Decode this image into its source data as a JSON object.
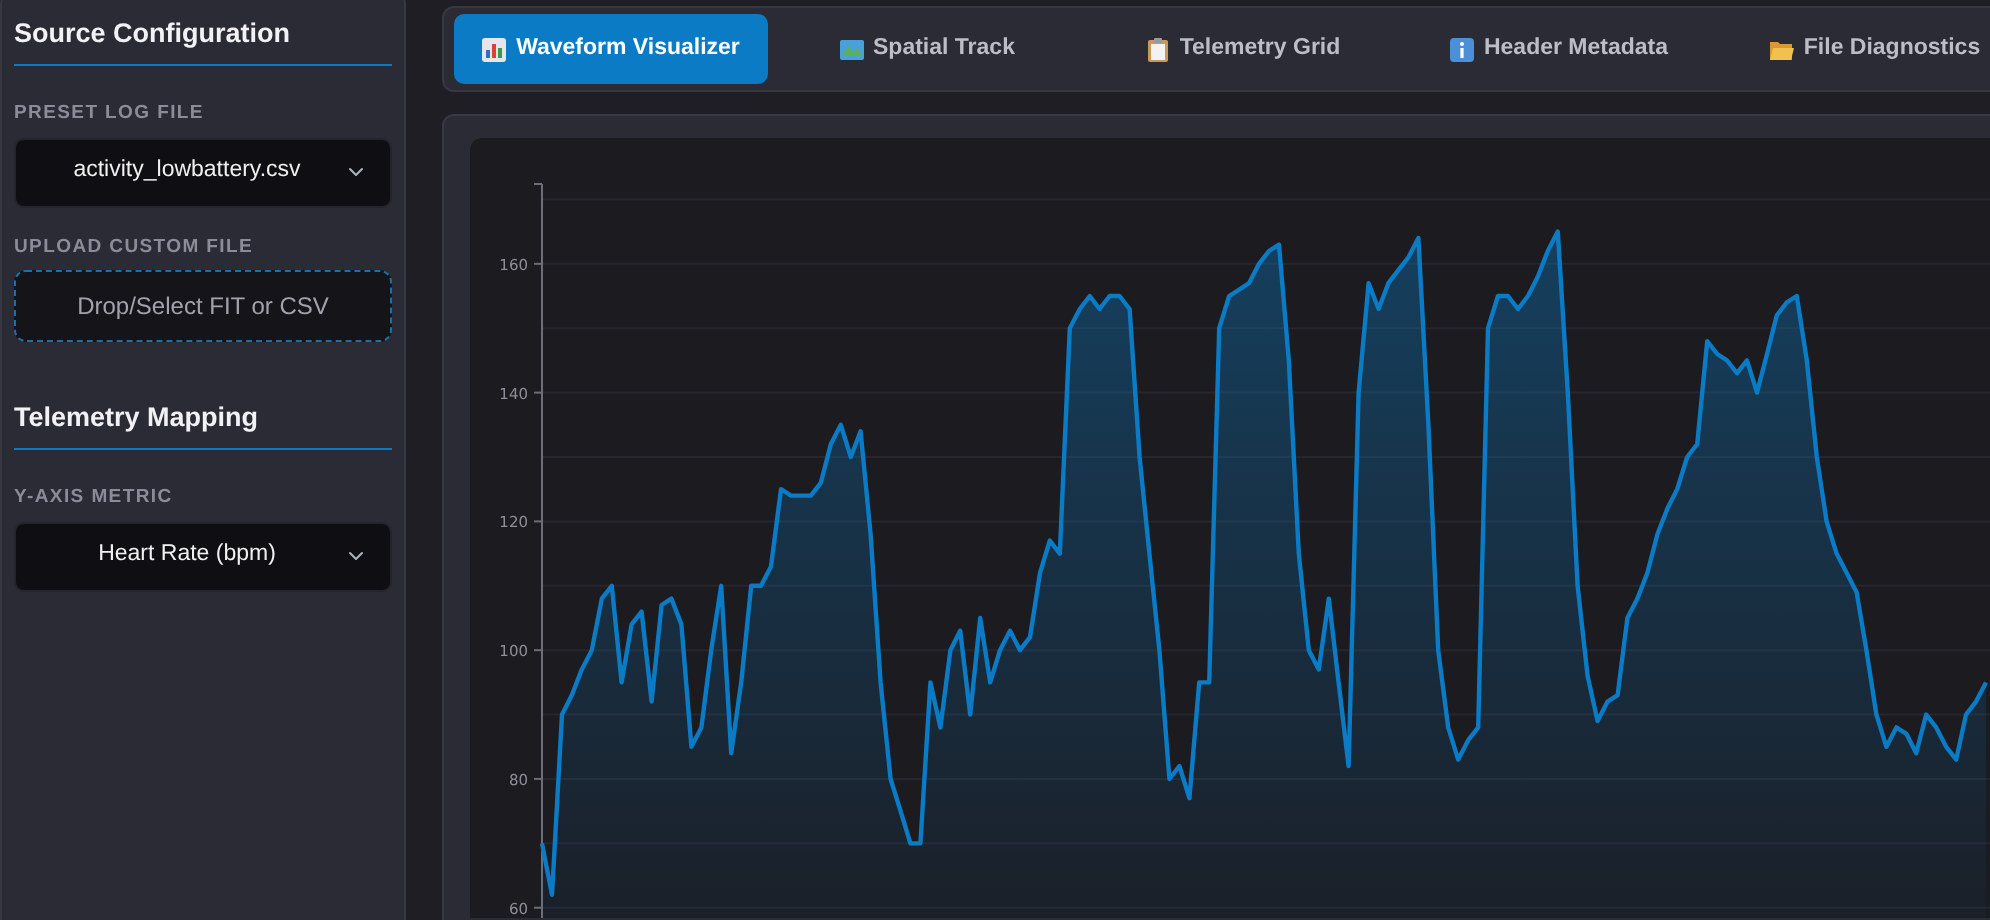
{
  "sidebar": {
    "sections": [
      {
        "title": "Source Configuration",
        "fields": [
          {
            "kind": "select",
            "label": "PRESET LOG FILE",
            "value": "activity_lowbattery.csv"
          },
          {
            "kind": "dropzone",
            "label": "UPLOAD CUSTOM FILE",
            "prompt": "Drop/Select FIT or CSV"
          }
        ]
      },
      {
        "title": "Telemetry Mapping",
        "fields": [
          {
            "kind": "select",
            "label": "Y-AXIS METRIC",
            "value": "Heart Rate (bpm)"
          }
        ]
      }
    ]
  },
  "tabs": [
    {
      "label": "Waveform Visualizer",
      "selected": true
    },
    {
      "label": "Spatial Track",
      "selected": false
    },
    {
      "label": "Telemetry Grid",
      "selected": false
    },
    {
      "label": "Header Metadata",
      "selected": false
    },
    {
      "label": "File Diagnostics",
      "selected": false
    }
  ],
  "chart": {
    "chart_data": {
      "type": "area",
      "ylim": [
        58.4,
        172.4
      ],
      "yticks": [
        60,
        80,
        100,
        120,
        140,
        160
      ],
      "grid": true,
      "series": [
        {
          "color": "#0a7bc4",
          "values": [
            70,
            62,
            90,
            93,
            97,
            100,
            108,
            110,
            95,
            104,
            106,
            92,
            107,
            108,
            104,
            85,
            88,
            100,
            110,
            84,
            95,
            110,
            110,
            113,
            125,
            124,
            124,
            124,
            126,
            132,
            135,
            130,
            134,
            118,
            95,
            80,
            75,
            70,
            70,
            95,
            88,
            100,
            103,
            90,
            105,
            95,
            100,
            103,
            100,
            102,
            112,
            117,
            115,
            150,
            153,
            155,
            153,
            155,
            155,
            153,
            130,
            115,
            100,
            80,
            82,
            77,
            95,
            95,
            150,
            155,
            156,
            157,
            160,
            162,
            163,
            145,
            115,
            100,
            97,
            108,
            95,
            82,
            140,
            157,
            153,
            157,
            159,
            161,
            164,
            135,
            100,
            88,
            83,
            86,
            88,
            150,
            155,
            155,
            153,
            155,
            158,
            162,
            165,
            140,
            110,
            96,
            89,
            92,
            93,
            105,
            108,
            112,
            118,
            122,
            125,
            130,
            132,
            148,
            146,
            145,
            143,
            145,
            140,
            146,
            152,
            154,
            155,
            145,
            130,
            120,
            115,
            112,
            109,
            100,
            90,
            85,
            88,
            87,
            84,
            90,
            88,
            85,
            83,
            90,
            92,
            95
          ]
        }
      ]
    }
  }
}
